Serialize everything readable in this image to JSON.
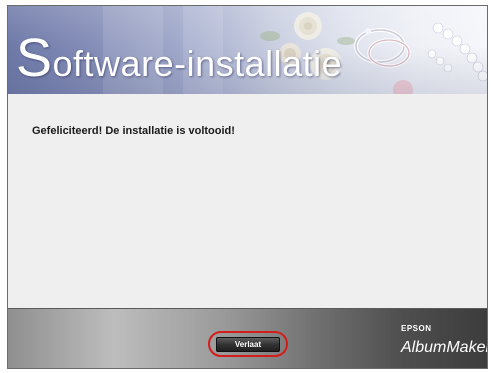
{
  "banner": {
    "title_initial": "S",
    "title_rest": "oftware-installatie"
  },
  "content": {
    "message": "Gefeliciteerd! De installatie is voltooid!"
  },
  "footer": {
    "exit_label": "Verlaat",
    "brand_maker": "EPSON",
    "brand_product": "AlbumMaker"
  },
  "colors": {
    "highlight_ring": "#d51c1c",
    "banner_accent": "#6e79a8"
  },
  "icons": {
    "banner_decoration": "wedding-rings-and-roses"
  }
}
